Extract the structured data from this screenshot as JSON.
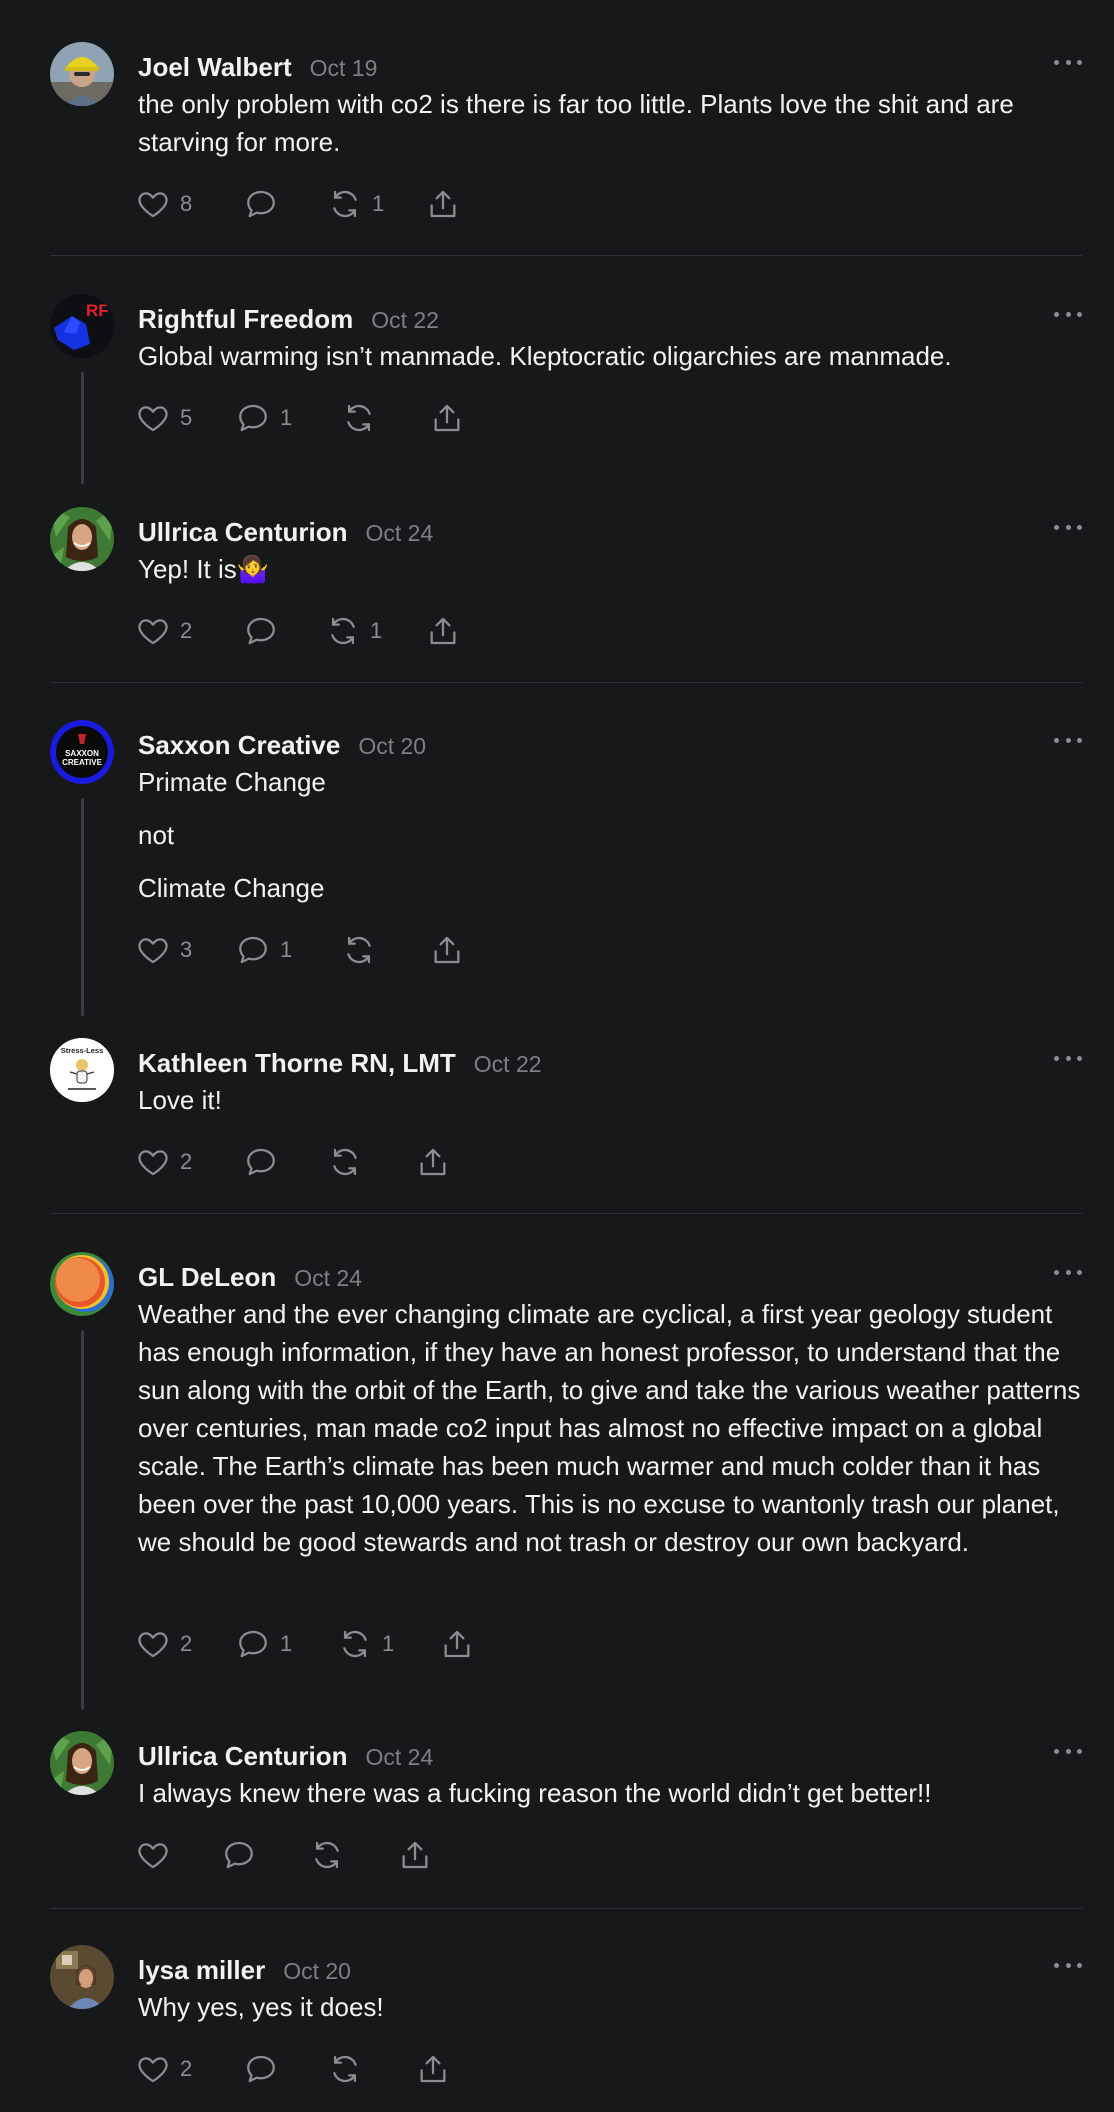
{
  "theme": {
    "background": "#17181a",
    "text": "#f2f2f2",
    "muted": "#7d7f84",
    "icon": "#8b8d92",
    "divider": "#2e3034"
  },
  "comments": [
    {
      "name": "Joel Walbert",
      "date": "Oct 19",
      "body": [
        "the only problem with co2 is there is far too little. Plants love the shit and are starving for more."
      ],
      "likes": "8",
      "replies": "",
      "reposts": "1"
    },
    {
      "name": "Rightful Freedom",
      "date": "Oct 22",
      "body": [
        "Global warming isn’t manmade. Kleptocratic oligarchies are manmade."
      ],
      "likes": "5",
      "replies": "1",
      "reposts": "",
      "avatar_text": "RF"
    },
    {
      "name": "Ullrica Centurion",
      "date": "Oct 24",
      "body": [
        "Yep! It is🤷‍♀️"
      ],
      "likes": "2",
      "replies": "",
      "reposts": "1"
    },
    {
      "name": "Saxxon Creative",
      "date": "Oct 20",
      "body": [
        "Primate Change",
        "not",
        "Climate Change"
      ],
      "likes": "3",
      "replies": "1",
      "reposts": "",
      "avatar_text": [
        "SAXXON",
        "CREATIVE"
      ]
    },
    {
      "name": "Kathleen Thorne RN, LMT",
      "date": "Oct 22",
      "body": [
        "Love it!"
      ],
      "likes": "2",
      "replies": "",
      "reposts": "",
      "avatar_text": "Stress-Less"
    },
    {
      "name": "GL DeLeon",
      "date": "Oct 24",
      "body": [
        "Weather and the ever changing climate are cyclical, a first year geology student has enough information, if they have an honest professor, to understand that the sun along with the orbit of the Earth, to give and take the various weather patterns over centuries, man made co2 input has almost no effective impact on a global scale. The Earth’s climate has been much warmer and much colder than it has been over the past 10,000 years. This is no excuse to wantonly trash our planet, we should be good stewards and not trash or destroy our own backyard."
      ],
      "likes": "2",
      "replies": "1",
      "reposts": "1"
    },
    {
      "name": "Ullrica Centurion",
      "date": "Oct 24",
      "body": [
        "I always knew there was a fucking reason the world didn’t get better!!"
      ],
      "likes": "",
      "replies": "",
      "reposts": ""
    },
    {
      "name": "lysa miller",
      "date": "Oct 20",
      "body": [
        "Why yes, yes it does!"
      ],
      "likes": "2",
      "replies": "",
      "reposts": ""
    }
  ],
  "icons": {
    "like": "heart-icon",
    "reply": "speech-bubble-icon",
    "repost": "repost-arrows-icon",
    "share": "share-upload-icon",
    "more": "more-dots-icon"
  }
}
